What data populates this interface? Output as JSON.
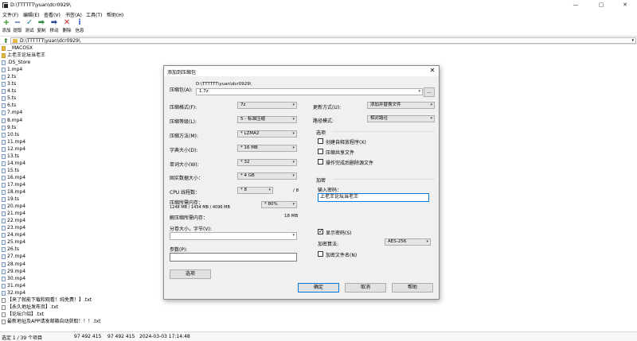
{
  "window": {
    "title": "D:\\TTTTTT\\yuan\\dcr0929\\",
    "minimize": "—",
    "maximize": "▢",
    "close": "✕"
  },
  "menu": [
    "文件(F)",
    "编辑(E)",
    "查看(V)",
    "书签(A)",
    "工具(T)",
    "帮助(H)"
  ],
  "toolbar": [
    {
      "label": "添加",
      "icon": "add-icon",
      "glyph": "+",
      "color": "#2a9a2a"
    },
    {
      "label": "提取",
      "icon": "extract-icon",
      "glyph": "−",
      "color": "#2a4aa8"
    },
    {
      "label": "测试",
      "icon": "test-icon",
      "glyph": "✓",
      "color": "#2a8a9a"
    },
    {
      "label": "复制",
      "icon": "copy-icon",
      "glyph": "➡",
      "color": "#2a8a3a"
    },
    {
      "label": "移动",
      "icon": "move-icon",
      "glyph": "➡",
      "color": "#2a4a9a"
    },
    {
      "label": "删除",
      "icon": "delete-icon",
      "glyph": "✕",
      "color": "#c82828"
    },
    {
      "label": "信息",
      "icon": "info-icon",
      "glyph": "i",
      "color": "#3a6ac8"
    }
  ],
  "address": {
    "path": "D:\\TTTTTT\\yuan\\dcr0929\\",
    "dropdown": "▾"
  },
  "files": [
    {
      "name": "__MACOSX",
      "type": "folder"
    },
    {
      "name": "上老王论坛当老王",
      "type": "folder"
    },
    {
      "name": ".DS_Store",
      "type": "file"
    },
    {
      "name": "1.mp4",
      "type": "file"
    },
    {
      "name": "2.ts",
      "type": "file"
    },
    {
      "name": "3.ts",
      "type": "file"
    },
    {
      "name": "4.ts",
      "type": "file"
    },
    {
      "name": "5.ts",
      "type": "file"
    },
    {
      "name": "6.ts",
      "type": "file"
    },
    {
      "name": "7.mp4",
      "type": "file"
    },
    {
      "name": "8.mp4",
      "type": "file"
    },
    {
      "name": "9.ts",
      "type": "file"
    },
    {
      "name": "10.ts",
      "type": "file"
    },
    {
      "name": "11.mp4",
      "type": "file"
    },
    {
      "name": "12.mp4",
      "type": "file"
    },
    {
      "name": "13.ts",
      "type": "file"
    },
    {
      "name": "14.mp4",
      "type": "file"
    },
    {
      "name": "15.ts",
      "type": "file"
    },
    {
      "name": "16.mp4",
      "type": "file"
    },
    {
      "name": "17.mp4",
      "type": "file"
    },
    {
      "name": "18.mp4",
      "type": "file"
    },
    {
      "name": "19.ts",
      "type": "file"
    },
    {
      "name": "20.mp4",
      "type": "file"
    },
    {
      "name": "21.mp4",
      "type": "file"
    },
    {
      "name": "22.mp4",
      "type": "file"
    },
    {
      "name": "23.mp4",
      "type": "file"
    },
    {
      "name": "24.mp4",
      "type": "file"
    },
    {
      "name": "25.mp4",
      "type": "file"
    },
    {
      "name": "26.ts",
      "type": "file"
    },
    {
      "name": "27.mp4",
      "type": "file"
    },
    {
      "name": "28.mp4",
      "type": "file"
    },
    {
      "name": "29.mp4",
      "type": "file"
    },
    {
      "name": "30.mp4",
      "type": "file"
    },
    {
      "name": "31.mp4",
      "type": "file"
    },
    {
      "name": "32.mp4",
      "type": "file"
    },
    {
      "name": "【来了就能下载和观看！纯免费！】.txt",
      "type": "txt"
    },
    {
      "name": "【永久地址发布页】.txt",
      "type": "txt"
    },
    {
      "name": "【论坛介绍】.txt",
      "type": "txt"
    },
    {
      "name": "最新地址及APP请发邮箱自动获取！！！.txt",
      "type": "txt"
    }
  ],
  "status": {
    "selection": "选定 1 / 39 个项目",
    "size1": "97 492 415",
    "size2": "97 492 415",
    "modified": "2024-03-03 17:14:48"
  },
  "dialog": {
    "title": "添加到压缩包",
    "close": "✕",
    "archive_label": "压缩包(A):",
    "archive_dir": "D:\\TTTTTT\\yuan\\dcr0929\\",
    "archive_name": "1.7z",
    "browse": "...",
    "format_label": "压缩格式(F):",
    "format_value": "7z",
    "level_label": "压缩等级(L):",
    "level_value": "5 - 标准压缩",
    "method_label": "压缩方法(M):",
    "method_value": "* LZMA2",
    "dict_label": "字典大小(D):",
    "dict_value": "* 16 MB",
    "word_label": "单词大小(W):",
    "word_value": "* 32",
    "solid_label": "固实数据大小：",
    "solid_value": "* 4 GB",
    "cpu_label": "CPU 线程数：",
    "cpu_value": "* 8",
    "cpu_total": "/ 8",
    "mem_comp_label": "压缩所需内存：",
    "mem_comp_value": "1248 MB / 1434 MB / 4096 MB",
    "mem_pct": "* 80%",
    "mem_decomp_label": "解压缩所需内存：",
    "mem_decomp_value": "18 MB",
    "split_label": "分卷大小，字节(V):",
    "params_label": "参数(P):",
    "options_button": "选项",
    "update_label": "更新方式(U):",
    "update_value": "添加并替换文件",
    "pathmode_label": "路径模式:",
    "pathmode_value": "相对路径",
    "options_group": "选项",
    "opt_sfx": "创建自释放程序(X)",
    "opt_shared": "压缩共享文件",
    "opt_delete": "操作完成后删除源文件",
    "encryption_group": "加密",
    "password_label": "输入密码：",
    "password_value": "上老王论坛当老王",
    "show_password": "显示密码(S)",
    "enc_method_label": "加密算法:",
    "enc_method_value": "AES-256",
    "encrypt_names": "加密文件名(N)",
    "ok": "确定",
    "cancel": "取消",
    "help": "帮助"
  }
}
